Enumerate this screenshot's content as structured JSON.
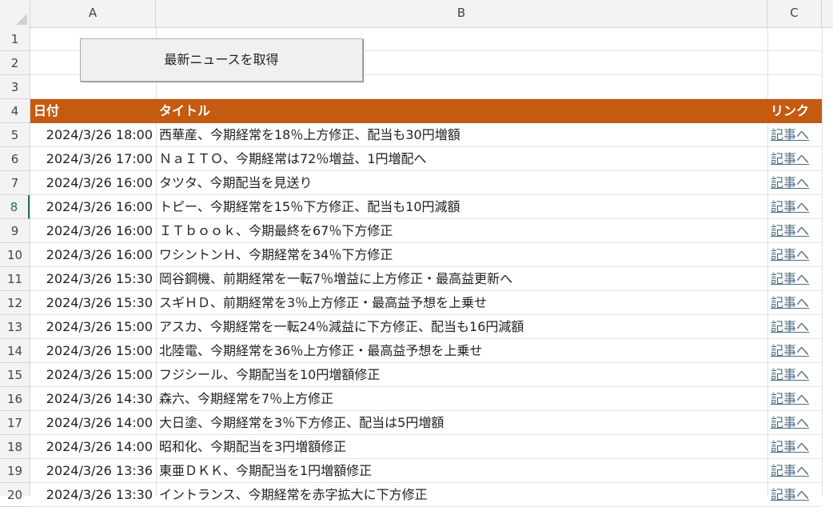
{
  "columns": [
    "A",
    "B",
    "C"
  ],
  "button_label": "最新ニュースを取得",
  "header": {
    "date": "日付",
    "title": "タイトル",
    "link": "リンク"
  },
  "rows": [
    {
      "num": "1"
    },
    {
      "num": "2"
    },
    {
      "num": "3"
    },
    {
      "num": "4"
    },
    {
      "num": "5",
      "date": "2024/3/26 18:00",
      "title": "西華産、今期経常を18％上方修正、配当も30円増額",
      "link": "記事へ"
    },
    {
      "num": "6",
      "date": "2024/3/26 17:00",
      "title": "ＮａＩＴＯ、今期経常は72％増益、1円増配へ",
      "link": "記事へ"
    },
    {
      "num": "7",
      "date": "2024/3/26 16:00",
      "title": "タツタ、今期配当を見送り",
      "link": "記事へ"
    },
    {
      "num": "8",
      "date": "2024/3/26 16:00",
      "title": "トピー、今期経常を15％下方修正、配当も10円減額",
      "link": "記事へ"
    },
    {
      "num": "9",
      "date": "2024/3/26 16:00",
      "title": "ＩＴｂｏｏｋ、今期最終を67％下方修正",
      "link": "記事へ"
    },
    {
      "num": "10",
      "date": "2024/3/26 16:00",
      "title": "ワシントンＨ、今期経常を34％下方修正",
      "link": "記事へ"
    },
    {
      "num": "11",
      "date": "2024/3/26 15:30",
      "title": "岡谷鋼機、前期経常を一転7％増益に上方修正・最高益更新へ",
      "link": "記事へ"
    },
    {
      "num": "12",
      "date": "2024/3/26 15:30",
      "title": "スギＨＤ、前期経常を3％上方修正・最高益予想を上乗せ",
      "link": "記事へ"
    },
    {
      "num": "13",
      "date": "2024/3/26 15:00",
      "title": "アスカ、今期経常を一転24％減益に下方修正、配当も16円減額",
      "link": "記事へ"
    },
    {
      "num": "14",
      "date": "2024/3/26 15:00",
      "title": "北陸電、今期経常を36％上方修正・最高益予想を上乗せ",
      "link": "記事へ"
    },
    {
      "num": "15",
      "date": "2024/3/26 15:00",
      "title": "フジシール、今期配当を10円増額修正",
      "link": "記事へ"
    },
    {
      "num": "16",
      "date": "2024/3/26 14:30",
      "title": "森六、今期経常を7％上方修正",
      "link": "記事へ"
    },
    {
      "num": "17",
      "date": "2024/3/26 14:00",
      "title": "大日塗、今期経常を3％下方修正、配当は5円増額",
      "link": "記事へ"
    },
    {
      "num": "18",
      "date": "2024/3/26 14:00",
      "title": "昭和化、今期配当を3円増額修正",
      "link": "記事へ"
    },
    {
      "num": "19",
      "date": "2024/3/26 13:36",
      "title": "東亜ＤＫＫ、今期配当を1円増額修正",
      "link": "記事へ"
    },
    {
      "num": "20",
      "date": "2024/3/26 13:30",
      "title": "イントランス、今期経常を赤字拡大に下方修正",
      "link": "記事へ"
    }
  ],
  "active_row": "8",
  "colors": {
    "header_band": "#c55a11",
    "link": "#4d6f85",
    "active": "#217346"
  }
}
